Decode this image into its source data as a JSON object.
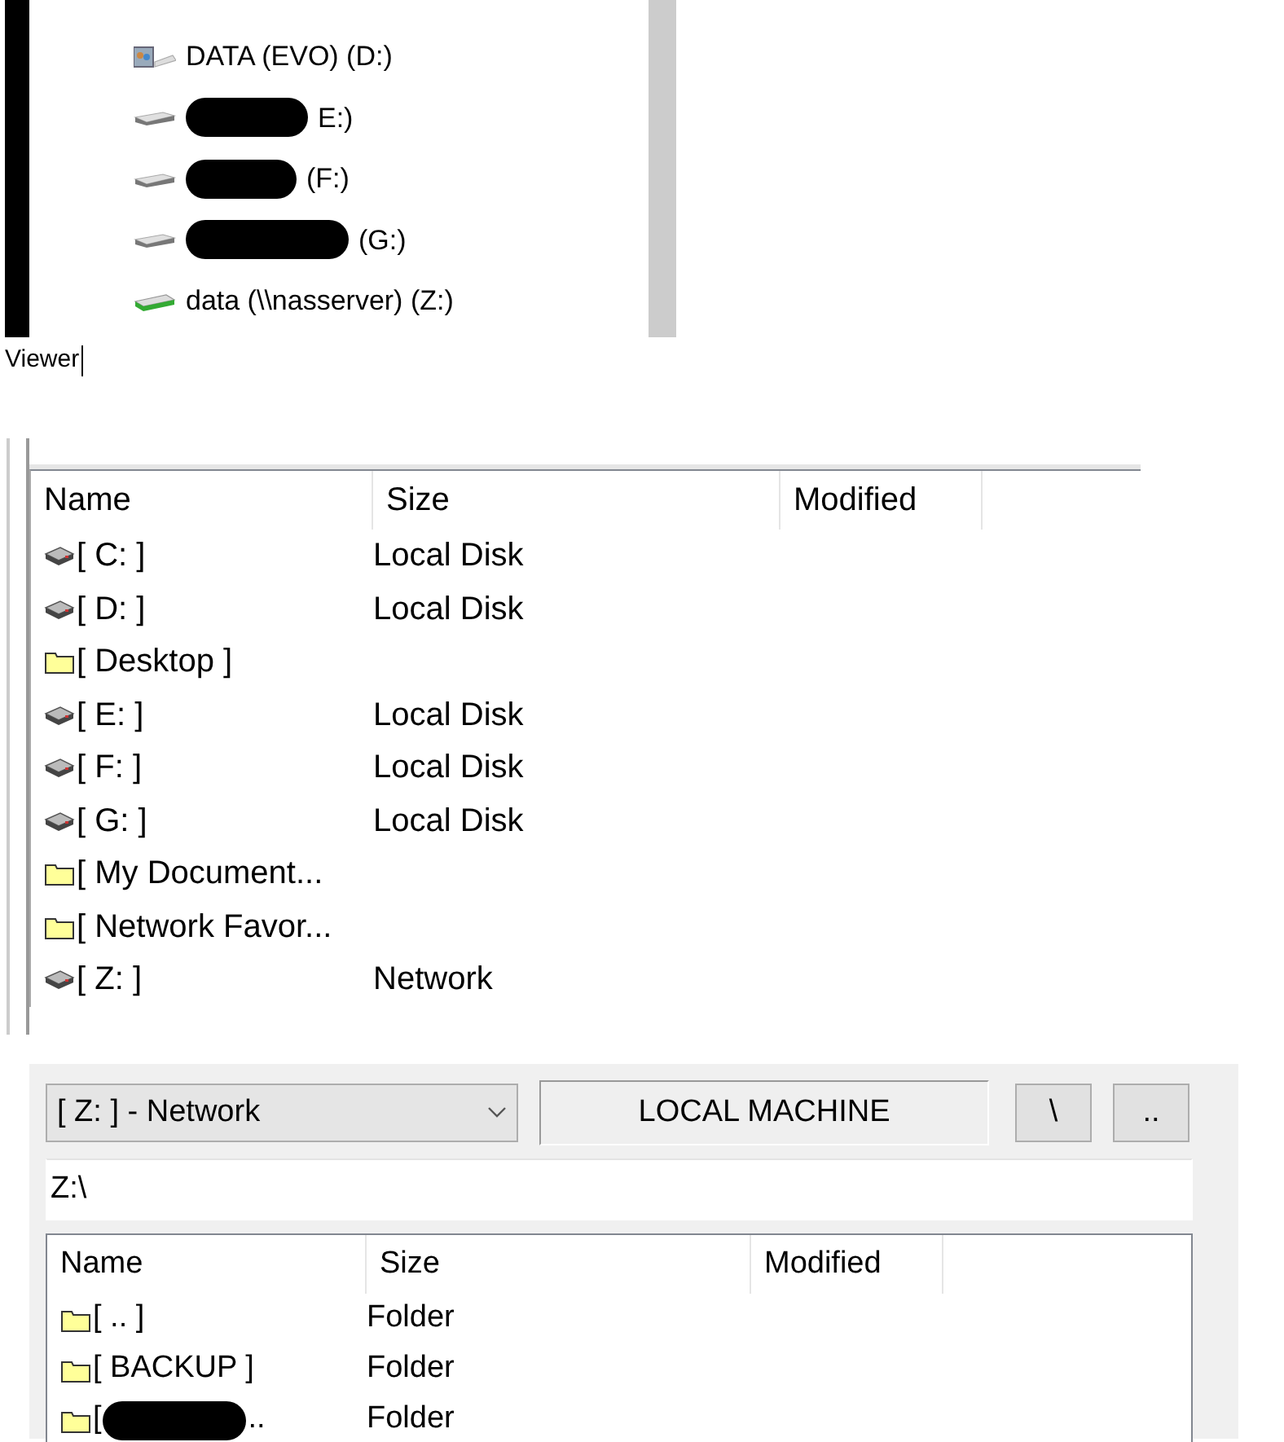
{
  "drives_pane": {
    "items": [
      {
        "label": "DATA (EVO) (D:)",
        "kind": "photo",
        "redacted": false
      },
      {
        "label": "E:)",
        "kind": "disk",
        "redacted": true
      },
      {
        "label": "(F:)",
        "kind": "disk",
        "redacted": true
      },
      {
        "label": "(G:)",
        "kind": "disk",
        "redacted": true
      },
      {
        "label": "data (\\\\nasserver) (Z:)",
        "kind": "network",
        "redacted": false
      }
    ]
  },
  "caption": {
    "text": "Viewer",
    "caret": true
  },
  "file_list": {
    "columns": [
      "Name",
      "Size",
      "Modified"
    ],
    "rows": [
      {
        "name": "[ C: ]",
        "size": "Local Disk",
        "kind": "drive"
      },
      {
        "name": "[ D: ]",
        "size": "Local Disk",
        "kind": "drive"
      },
      {
        "name": "[ Desktop ]",
        "kind": "folder"
      },
      {
        "name": "[ E: ]",
        "size": "Local Disk",
        "kind": "drive"
      },
      {
        "name": "[ F: ]",
        "size": "Local Disk",
        "kind": "drive"
      },
      {
        "name": "[ G: ]",
        "size": "Local Disk",
        "kind": "drive"
      },
      {
        "name": "[ My Document...",
        "kind": "folder"
      },
      {
        "name": "[ Network Favor...",
        "kind": "folder"
      },
      {
        "name": "[ Z: ]",
        "size": "Network",
        "kind": "drive"
      }
    ]
  },
  "remote_panel": {
    "drive_select": {
      "value": "[ Z: ] - Network"
    },
    "location_label": "LOCAL MACHINE",
    "buttons": [
      "\\",
      ".."
    ],
    "path_field": {
      "value": "Z:\\"
    },
    "file_list": {
      "columns": [
        "Name",
        "Size",
        "Modified"
      ],
      "rows": [
        {
          "name": "[ .. ]",
          "size": "Folder",
          "kind": "folder"
        },
        {
          "name": "[ BACKUP ]",
          "size": "Folder",
          "kind": "folder"
        },
        {
          "name": "[",
          "name_after": "..",
          "redacted": true,
          "size": "Folder",
          "kind": "folder"
        }
      ]
    }
  }
}
